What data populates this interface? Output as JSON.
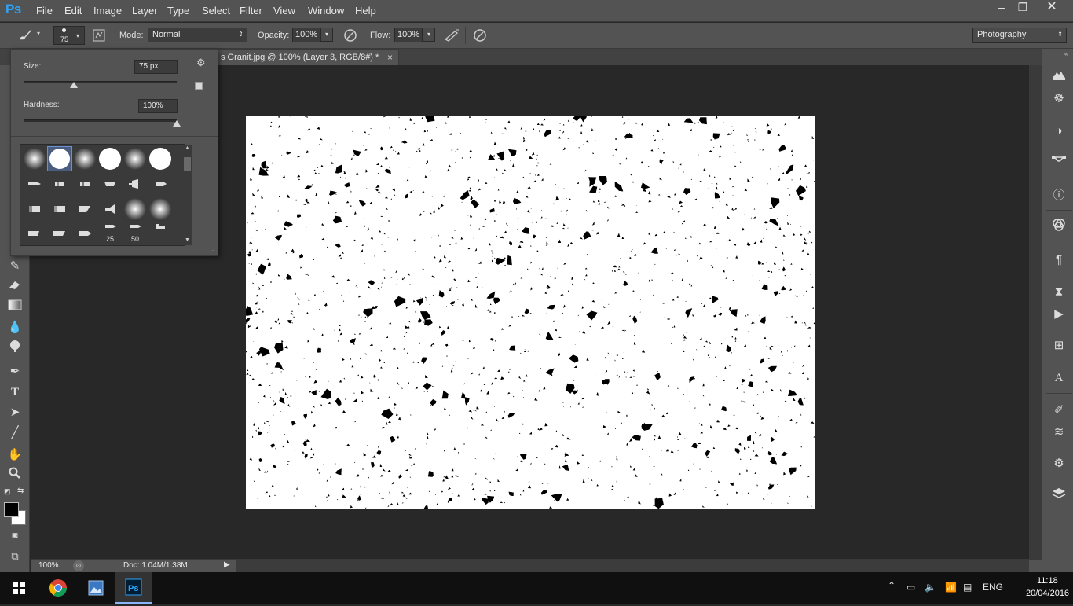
{
  "app": {
    "logo": "Ps"
  },
  "menu": [
    "File",
    "Edit",
    "Image",
    "Layer",
    "Type",
    "Select",
    "Filter",
    "View",
    "Window",
    "Help"
  ],
  "window_controls": {
    "minimize": "–",
    "restore": "❐",
    "close": "✕"
  },
  "options_bar": {
    "brush_size": "75",
    "mode_label": "Mode:",
    "mode_value": "Normal",
    "opacity_label": "Opacity:",
    "opacity_value": "100%",
    "flow_label": "Flow:",
    "flow_value": "100%",
    "workspace": "Photography"
  },
  "document_tab": {
    "title": "s Granit.jpg @ 100% (Layer 3, RGB/8#) *",
    "close": "×"
  },
  "brush_picker": {
    "size_label": "Size:",
    "size_value": "75 px",
    "size_slider": 0.33,
    "hardness_label": "Hardness:",
    "hardness_value": "100%",
    "hardness_slider": 1.0,
    "brush_numbers": [
      "25",
      "50"
    ]
  },
  "status_bar": {
    "zoom": "100%",
    "doc_info": "Doc: 1.04M/1.38M"
  },
  "taskbar": {
    "language": "ENG",
    "time": "11:18",
    "date": "20/04/2016"
  },
  "colors": {
    "accent": "#2fa3f7",
    "chrome": "#535353",
    "canvas_bg": "#282828",
    "foreground": "#000000",
    "background": "#ffffff"
  }
}
